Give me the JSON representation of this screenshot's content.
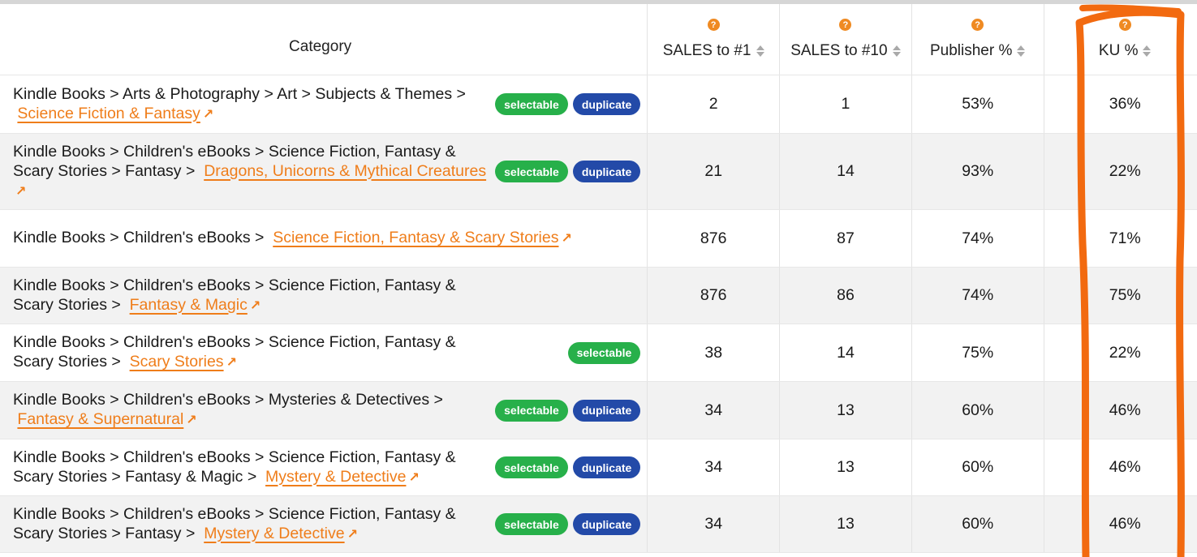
{
  "columns": {
    "category": "Category",
    "sales1": "SALES to #1",
    "sales10": "SALES to #10",
    "publisher": "Publisher %",
    "ku": "KU %",
    "help_icon": "?"
  },
  "badges": {
    "selectable": "selectable",
    "duplicate": "duplicate"
  },
  "rows": [
    {
      "path_a": "Kindle Books > Arts & Photography > Art > Subjects & Themes >",
      "path_b": "",
      "link": "Science Fiction & Fantasy",
      "sales1": "2",
      "sales10": "1",
      "publisher": "53%",
      "ku": "36%"
    },
    {
      "path_a": "Kindle Books > Children's eBooks > Science Fiction, Fantasy &",
      "path_b": "Scary Stories > Fantasy >",
      "link": "Dragons, Unicorns & Mythical Creatures",
      "sales1": "21",
      "sales10": "14",
      "publisher": "93%",
      "ku": "22%"
    },
    {
      "path_a": "Kindle Books > Children's eBooks >",
      "path_b": "",
      "link": "Science Fiction, Fantasy & Scary Stories",
      "sales1": "876",
      "sales10": "87",
      "publisher": "74%",
      "ku": "71%"
    },
    {
      "path_a": "Kindle Books > Children's eBooks > Science Fiction, Fantasy &",
      "path_b": "Scary Stories >",
      "link": "Fantasy & Magic",
      "sales1": "876",
      "sales10": "86",
      "publisher": "74%",
      "ku": "75%"
    },
    {
      "path_a": "Kindle Books > Children's eBooks > Science Fiction, Fantasy &",
      "path_b": "Scary Stories >",
      "link": "Scary Stories",
      "sales1": "38",
      "sales10": "14",
      "publisher": "75%",
      "ku": "22%"
    },
    {
      "path_a": "Kindle Books > Children's eBooks > Mysteries & Detectives >",
      "path_b": "",
      "link": "Fantasy & Supernatural",
      "sales1": "34",
      "sales10": "13",
      "publisher": "60%",
      "ku": "46%"
    },
    {
      "path_a": "Kindle Books > Children's eBooks > Science Fiction, Fantasy &",
      "path_b": "Scary Stories > Fantasy & Magic >",
      "link": "Mystery & Detective",
      "sales1": "34",
      "sales10": "13",
      "publisher": "60%",
      "ku": "46%"
    },
    {
      "path_a": "Kindle Books > Children's eBooks > Science Fiction, Fantasy &",
      "path_b": "Scary Stories > Fantasy >",
      "link": "Mystery & Detective",
      "sales1": "34",
      "sales10": "13",
      "publisher": "60%",
      "ku": "46%"
    }
  ],
  "colors": {
    "link": "#ef7d1a",
    "selectable": "#27b04a",
    "duplicate": "#234aa8",
    "highlight": "#f26a10"
  }
}
